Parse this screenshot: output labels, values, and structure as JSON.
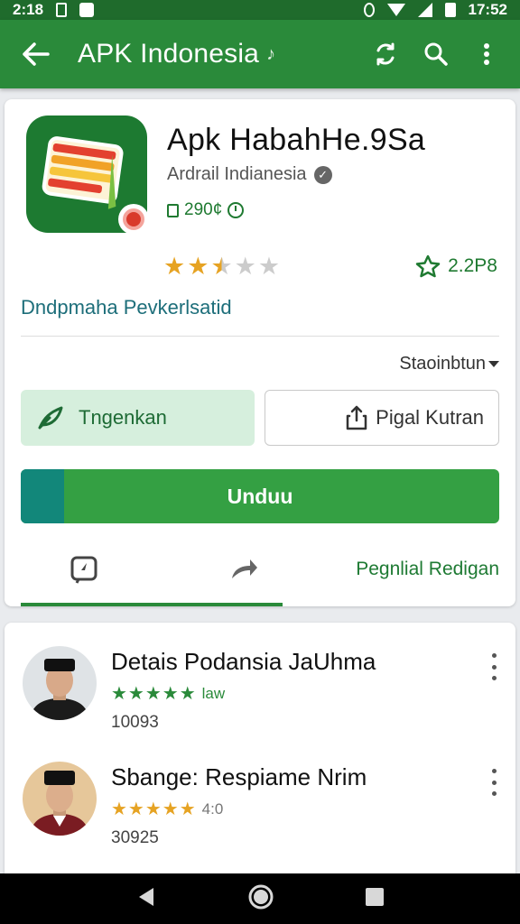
{
  "status_bar": {
    "time_left": "2:18",
    "time_right": "17:52"
  },
  "app_bar": {
    "title": "APK Indonesia",
    "title_suffix": "♪",
    "icons": [
      "arrow-back-icon",
      "share-icon",
      "search-icon",
      "more-vert-icon"
    ]
  },
  "app": {
    "title": "Apk HabahHe.9Sa",
    "developer": "Ardrail Indianesia",
    "size": "290¢",
    "rating_stars": 2.5,
    "rating_max": 5,
    "reviews": "2.2P8",
    "category": "Dndpmaha Pevkerlsatid",
    "sort_label": "Staoinbtun",
    "button_left": "Tngenkan",
    "button_right": "Pigal Kutran",
    "install_label": "Unduu",
    "install_progress": 0.09,
    "tab_3_label": "Pegnlial Redigan"
  },
  "reviews_list": [
    {
      "name": "Detais Podansia JaUhma",
      "stars": "★★★★★",
      "rating": "law",
      "count": "10093",
      "star_color": "#2a8a3a"
    },
    {
      "name": "Sbange: Respiame Nrim",
      "stars": "★★★★★",
      "rating": "4:0",
      "count": "30925",
      "star_color": "#e6a323"
    }
  ],
  "colors": {
    "primary": "#2a8a3a",
    "accent": "#34a043",
    "progress": "#12877a",
    "star": "#e6a323"
  }
}
